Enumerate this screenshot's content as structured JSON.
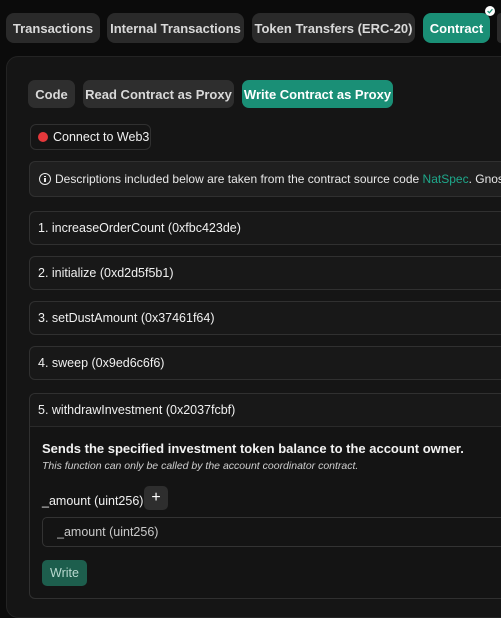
{
  "tabs": [
    {
      "label": "Transactions"
    },
    {
      "label": "Internal Transactions"
    },
    {
      "label": "Token Transfers (ERC-20)"
    },
    {
      "label": "Contract",
      "active": true
    }
  ],
  "subtabs": [
    {
      "label": "Code"
    },
    {
      "label": "Read Contract as Proxy"
    },
    {
      "label": "Write Contract as Proxy",
      "active": true
    }
  ],
  "connect": {
    "label": "Connect to Web3",
    "status_color": "#e5383b"
  },
  "info": {
    "text_before": "Descriptions included below are taken from the contract source code",
    "link": "NatSpec",
    "text_after": ". Gnosi"
  },
  "functions": [
    {
      "label": "1. increaseOrderCount (0xfbc423de)"
    },
    {
      "label": "2. initialize (0xd2d5f5b1)"
    },
    {
      "label": "3. setDustAmount (0x37461f64)"
    },
    {
      "label": "4. sweep (0x9ed6c6f6)"
    }
  ],
  "expanded_function": {
    "label": "5. withdrawInvestment (0x2037fcbf)",
    "description": "Sends the specified investment token balance to the account owner.",
    "note": "This function can only be called by the account coordinator contract.",
    "param_label": "_amount (uint256)",
    "add_symbol": "+",
    "input_placeholder": "_amount (uint256)",
    "write_label": "Write"
  },
  "colors": {
    "accent": "#1a8f76",
    "link": "#1fa88b",
    "background": "#0b0b0b"
  },
  "icons": [
    "check-icon",
    "info-icon",
    "plus-icon"
  ]
}
